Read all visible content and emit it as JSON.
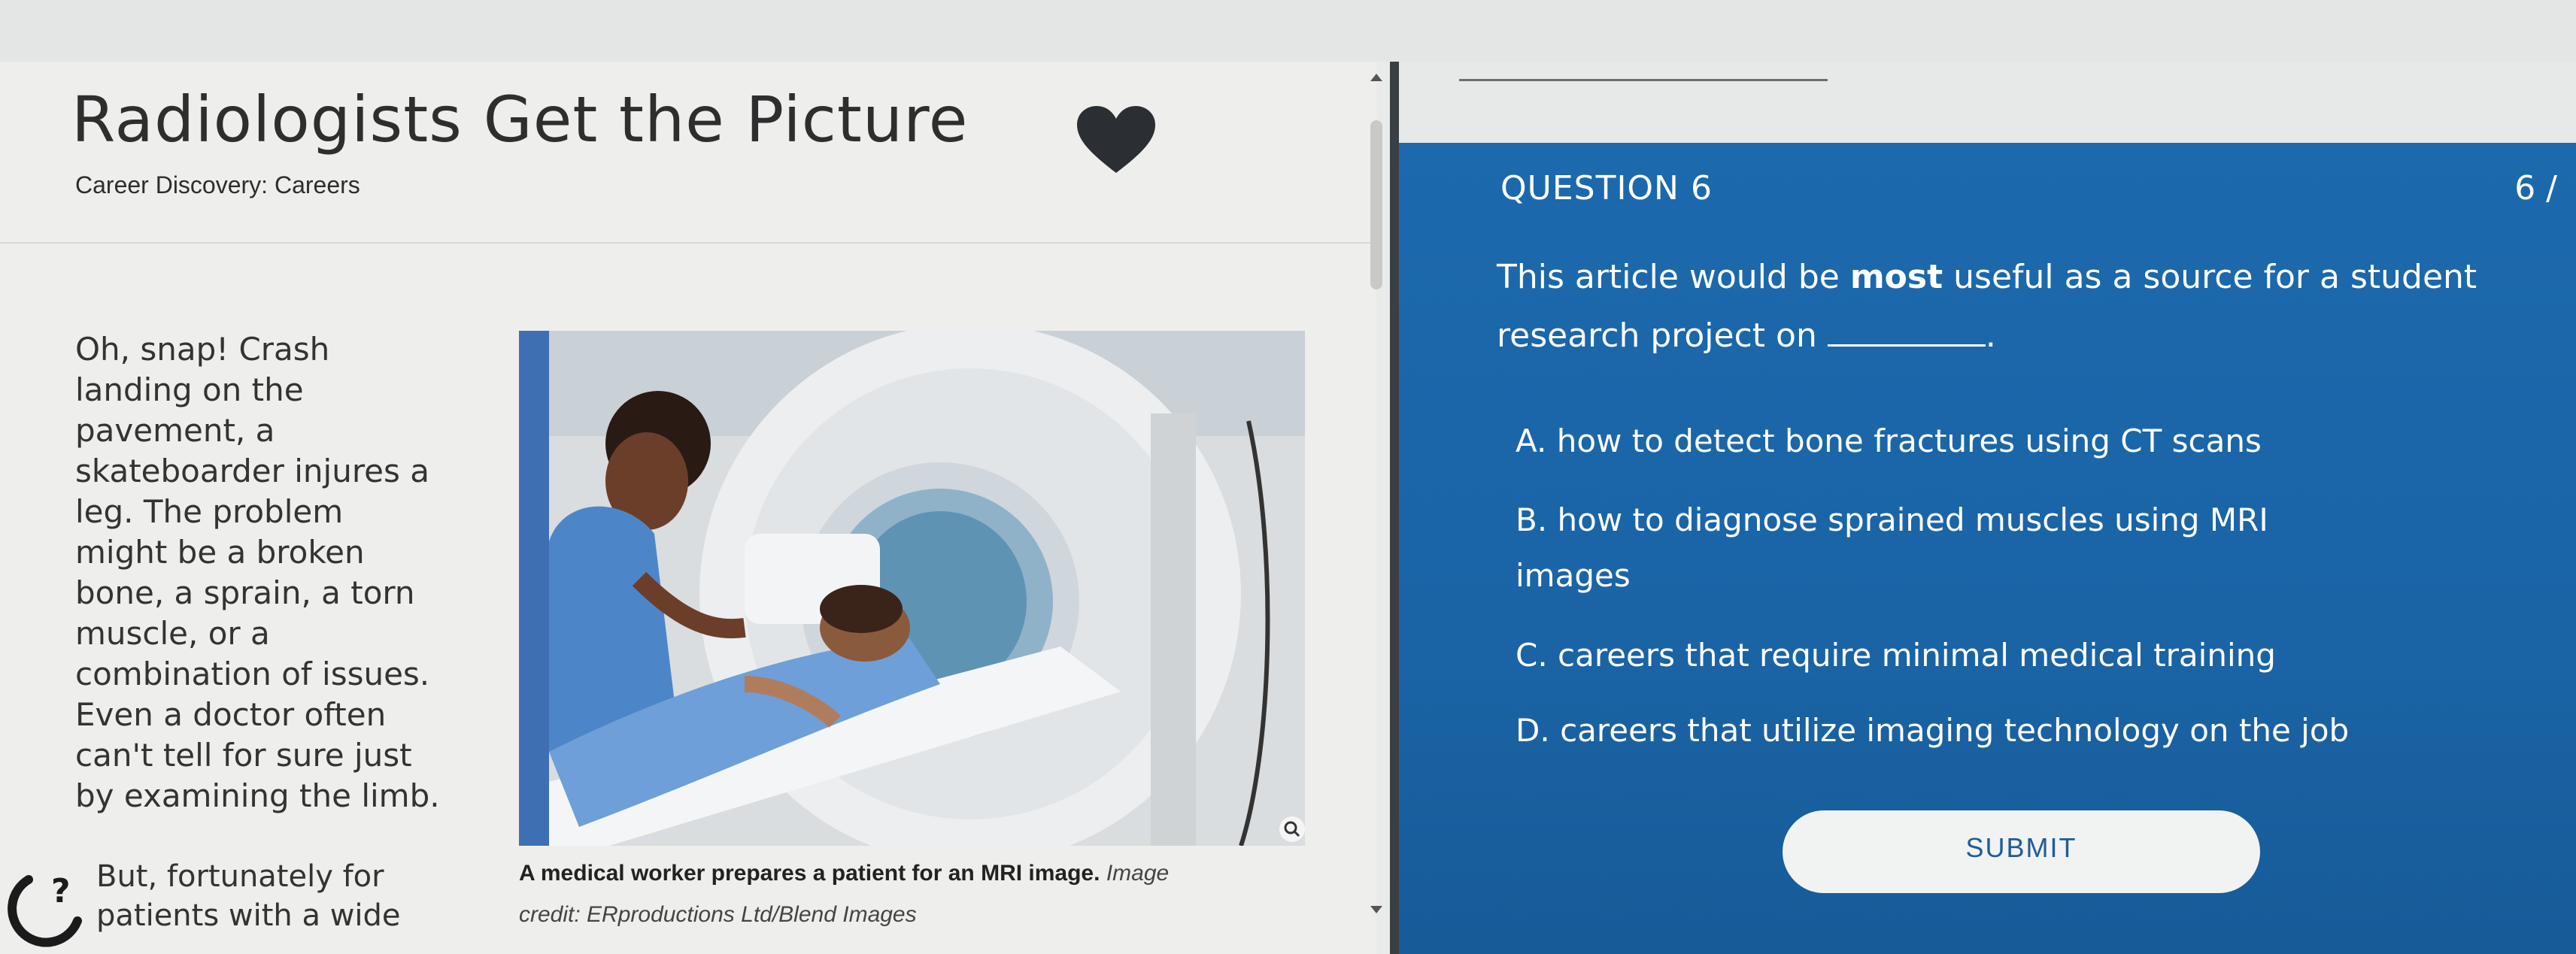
{
  "article": {
    "title": "Radiologists Get the Picture",
    "subtitle": "Career Discovery: Careers",
    "paragraph1": "Oh, snap! Crash\nlanding on the\npavement, a\nskateboarder injures a\nleg. The problem\nmight be a broken\nbone, a sprain, a torn\nmuscle, or a\ncombination of issues.\nEven a doctor often\ncan't tell for sure just\nby examining the limb.",
    "paragraph2": "But, fortunately for\npatients with a wide",
    "image_caption": "A medical worker prepares a patient for an MRI image.",
    "image_credit_1": "Image",
    "image_credit_2": "credit: ERproductions Ltd/Blend Images"
  },
  "question": {
    "label": "QUESTION 6",
    "count": "6 /",
    "text_before": "This article would be ",
    "text_emphasis": "most",
    "text_after": " useful as a source for a student research project on ",
    "text_end": ".",
    "options": [
      {
        "letter": "A.",
        "text": "how to detect bone fractures using CT scans"
      },
      {
        "letter": "B.",
        "text": "how to diagnose sprained muscles using MRI images"
      },
      {
        "letter": "C.",
        "text": "careers that require minimal medical training"
      },
      {
        "letter": "D.",
        "text": "careers that utilize imaging technology on the job"
      }
    ],
    "submit_label": "SUBMIT"
  },
  "colors": {
    "panel_blue": "#1b67aa",
    "heart": "#2b2e33",
    "submit_bg": "#f1f2f2"
  }
}
